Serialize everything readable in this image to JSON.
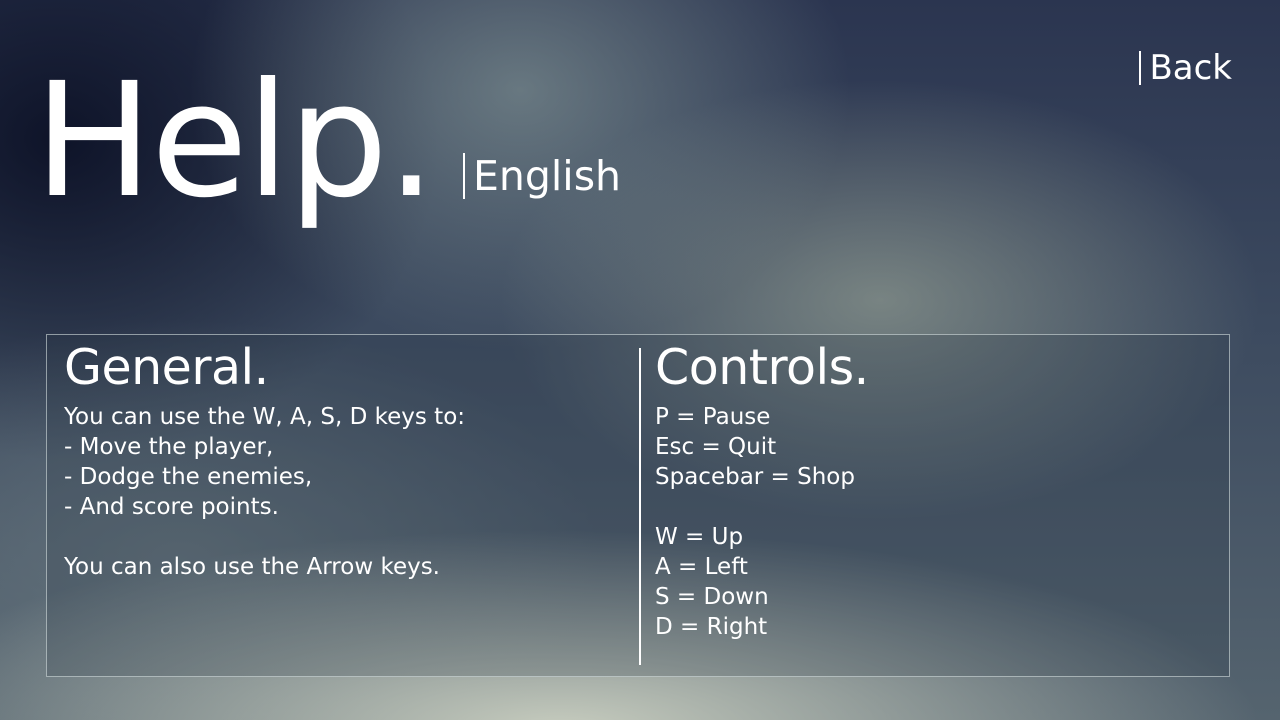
{
  "title": "Help.",
  "language_label": "English",
  "back_label": "Back",
  "general": {
    "heading": "General.",
    "lines": [
      "You can use the W, A, S, D keys to:",
      "- Move the player,",
      "- Dodge the enemies,",
      "- And score points."
    ],
    "extra": "You can also use the Arrow keys."
  },
  "controls": {
    "heading": "Controls.",
    "menu_keys": [
      "P = Pause",
      "Esc = Quit",
      "Spacebar = Shop"
    ],
    "movement_keys": [
      "W = Up",
      "A = Left",
      "S = Down",
      "D = Right"
    ]
  },
  "colors": {
    "text": "#ffffff",
    "panel_border": "#d7e1e1"
  }
}
